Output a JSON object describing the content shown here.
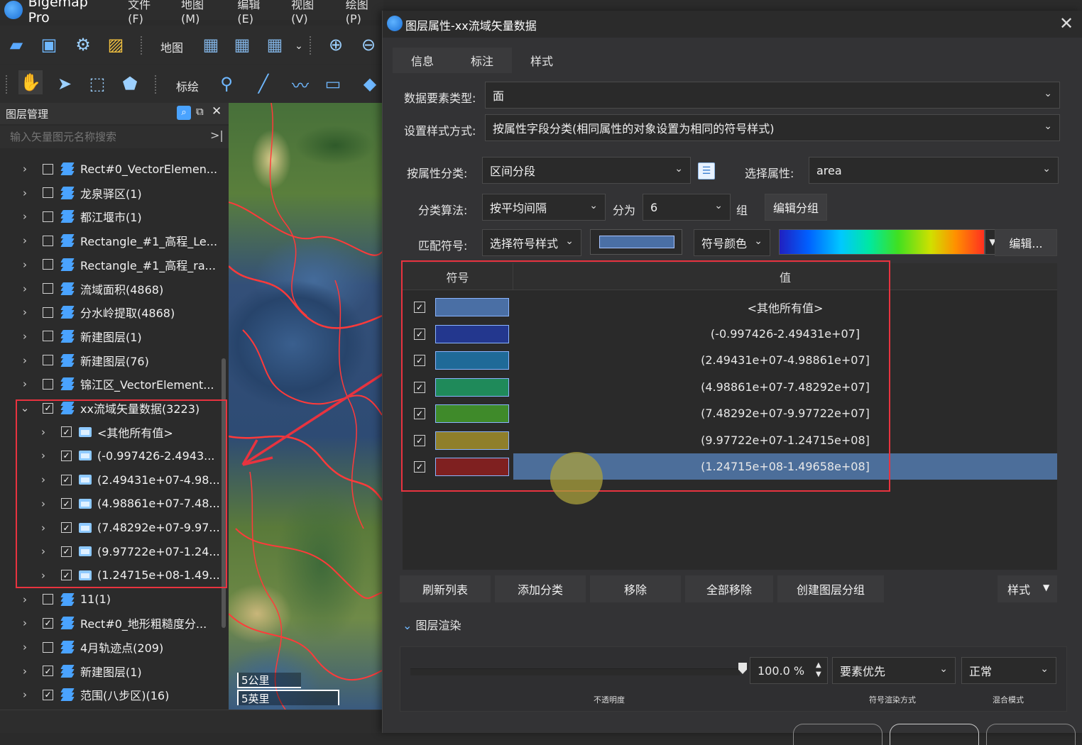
{
  "app": {
    "title": "Bigemap Pro"
  },
  "menu": [
    "文件(F)",
    "地图(M)",
    "编辑(E)",
    "视图(V)",
    "绘图(P)"
  ],
  "toolbar1": {
    "map_label": "地图"
  },
  "toolbar2": {
    "draw_label": "标绘"
  },
  "layer_panel": {
    "title": "图层管理",
    "search_placeholder": "输入矢量图元名称搜索",
    "layers": [
      {
        "label": "Rect#0_VectorElemen...",
        "checked": false,
        "kind": "layer",
        "indent": 0,
        "expanded": false
      },
      {
        "label": "龙泉驿区(1)",
        "checked": false,
        "kind": "layer",
        "indent": 0,
        "expanded": false
      },
      {
        "label": "都江堰市(1)",
        "checked": false,
        "kind": "layer",
        "indent": 0,
        "expanded": false
      },
      {
        "label": "Rectangle_#1_高程_Le...",
        "checked": false,
        "kind": "layer",
        "indent": 0,
        "expanded": false
      },
      {
        "label": "Rectangle_#1_高程_ra...",
        "checked": false,
        "kind": "layer",
        "indent": 0,
        "expanded": false
      },
      {
        "label": "流域面积(4868)",
        "checked": false,
        "kind": "layer",
        "indent": 0,
        "expanded": false
      },
      {
        "label": "分水岭提取(4868)",
        "checked": false,
        "kind": "layer",
        "indent": 0,
        "expanded": false
      },
      {
        "label": "新建图层(1)",
        "checked": false,
        "kind": "layer",
        "indent": 0,
        "expanded": false
      },
      {
        "label": "新建图层(76)",
        "checked": false,
        "kind": "layer",
        "indent": 0,
        "expanded": false
      },
      {
        "label": "锦江区_VectorElement...",
        "checked": false,
        "kind": "layer",
        "indent": 0,
        "expanded": false
      },
      {
        "label": "xx流域矢量数据(3223)",
        "checked": true,
        "kind": "layer",
        "indent": 0,
        "expanded": true
      },
      {
        "label": "<其他所有值>",
        "checked": true,
        "kind": "folder",
        "indent": 1,
        "expanded": false
      },
      {
        "label": "(-0.997426-2.4943...",
        "checked": true,
        "kind": "folder",
        "indent": 1,
        "expanded": false
      },
      {
        "label": "(2.49431e+07-4.98...",
        "checked": true,
        "kind": "folder",
        "indent": 1,
        "expanded": false
      },
      {
        "label": "(4.98861e+07-7.48...",
        "checked": true,
        "kind": "folder",
        "indent": 1,
        "expanded": false
      },
      {
        "label": "(7.48292e+07-9.97...",
        "checked": true,
        "kind": "folder",
        "indent": 1,
        "expanded": false
      },
      {
        "label": "(9.97722e+07-1.24...",
        "checked": true,
        "kind": "folder",
        "indent": 1,
        "expanded": false
      },
      {
        "label": "(1.24715e+08-1.49...",
        "checked": true,
        "kind": "folder",
        "indent": 1,
        "expanded": false
      },
      {
        "label": "11(1)",
        "checked": false,
        "kind": "layer",
        "indent": 0,
        "expanded": false
      },
      {
        "label": "Rect#0_地形粗糙度分...",
        "checked": true,
        "kind": "layer",
        "indent": 0,
        "expanded": false
      },
      {
        "label": "4月轨迹点(209)",
        "checked": false,
        "kind": "layer",
        "indent": 0,
        "expanded": false
      },
      {
        "label": "新建图层(1)",
        "checked": true,
        "kind": "layer",
        "indent": 0,
        "expanded": false
      },
      {
        "label": "范围(八步区)(16)",
        "checked": true,
        "kind": "layer",
        "indent": 0,
        "expanded": false
      }
    ]
  },
  "map": {
    "scale_km": "5公里",
    "scale_mi": "5英里"
  },
  "dialog": {
    "title": "图层属性-xx流域矢量数据",
    "tabs": [
      "信息",
      "标注",
      "样式"
    ],
    "active_tab": "样式",
    "feature_type_label": "数据要素类型:",
    "feature_type_value": "面",
    "style_method_label": "设置样式方式:",
    "style_method_value": "按属性字段分类(相同属性的对象设置为相同的符号样式)",
    "classify_label": "按属性分类:",
    "classify_value": "区间分段",
    "select_attr_label": "选择属性:",
    "select_attr_value": "area",
    "algo_label": "分类算法:",
    "algo_value": "按平均间隔",
    "divide_label": "分为",
    "divide_value": "6",
    "group_label": "组",
    "edit_group_label": "编辑分组",
    "match_symbol_label": "匹配符号:",
    "symbol_style_value": "选择符号样式",
    "symbol_color_value": "符号颜色",
    "edit_btn_label": "编辑...",
    "table": {
      "col_symbol": "符号",
      "col_value": "值",
      "rows": [
        {
          "value": "<其他所有值>",
          "color": "#4a6fa5",
          "checked": true
        },
        {
          "value": "(-0.997426-2.49431e+07]",
          "color": "#23378e",
          "checked": true
        },
        {
          "value": "(2.49431e+07-4.98861e+07]",
          "color": "#1f6a98",
          "checked": true
        },
        {
          "value": "(4.98861e+07-7.48292e+07]",
          "color": "#1f8a5a",
          "checked": true
        },
        {
          "value": "(7.48292e+07-9.97722e+07]",
          "color": "#3f8a2a",
          "checked": true
        },
        {
          "value": "(9.97722e+07-1.24715e+08]",
          "color": "#8f7f2a",
          "checked": true
        },
        {
          "value": "(1.24715e+08-1.49658e+08]",
          "color": "#7f2020",
          "checked": true
        }
      ],
      "selected_row": 6
    },
    "buttons": [
      "刷新列表",
      "添加分类",
      "移除",
      "全部移除",
      "创建图层分组"
    ],
    "style_dropdown": "样式",
    "render_section": "图层渲染",
    "opacity_value": "100.0 %",
    "opacity_caption": "不透明度",
    "render_mode_value": "要素优先",
    "render_mode_caption": "符号渲染方式",
    "blend_value": "正常",
    "blend_caption": "混合模式"
  }
}
